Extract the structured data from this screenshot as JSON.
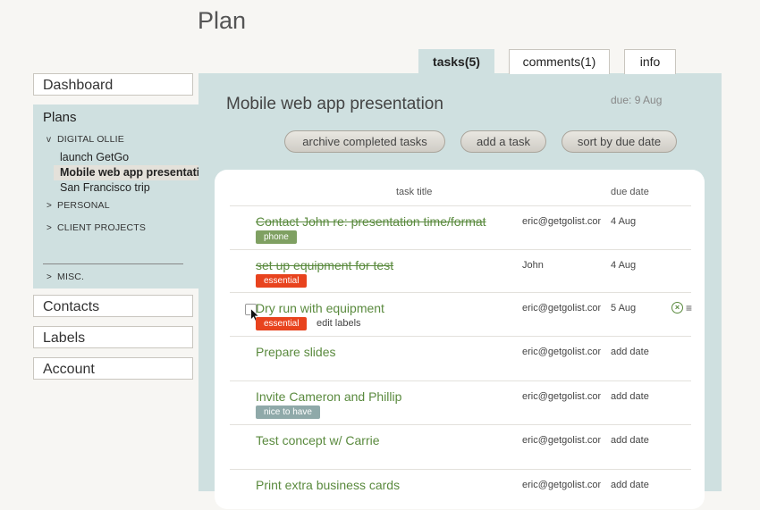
{
  "page": {
    "title": "Plan"
  },
  "sidebar": {
    "dashboard": "Dashboard",
    "plans_label": "Plans",
    "groups": [
      {
        "label": "DIGITAL OLLIE",
        "arrow": "v"
      },
      {
        "label": "PERSONAL",
        "arrow": ">"
      },
      {
        "label": "CLIENT PROJECTS",
        "arrow": ">"
      },
      {
        "label": "MISC.",
        "arrow": ">"
      }
    ],
    "plans": [
      "launch GetGo",
      "Mobile web app presentation",
      "San Francisco trip"
    ],
    "contacts": "Contacts",
    "labels": "Labels",
    "account": "Account"
  },
  "tabs": [
    "tasks(5)",
    "comments(1)",
    "info"
  ],
  "plan": {
    "title": "Mobile web app presentation",
    "due": "due: 9 Aug",
    "buttons": [
      "archive completed tasks",
      "add a task",
      "sort by due date"
    ]
  },
  "table": {
    "headers": {
      "title": "task title",
      "due": "due date"
    },
    "rows": [
      {
        "title": "Contact John re: presentation time/format",
        "assignee": "eric@getgolist.com",
        "date": "4 Aug",
        "tag": "phone",
        "done": true
      },
      {
        "title": "set up equipment for test",
        "assignee": "John",
        "date": "4 Aug",
        "tag": "essential",
        "done": true
      },
      {
        "title": "Dry run with equipment",
        "assignee": "eric@getgolist.com",
        "date": "5 Aug",
        "tag": "essential",
        "edit": "edit labels",
        "done": false
      },
      {
        "title": "Prepare slides",
        "assignee": "eric@getgolist.com",
        "date": "add date",
        "done": false
      },
      {
        "title": "Invite Cameron and Phillip",
        "assignee": "eric@getgolist.com",
        "date": "add date",
        "tag": "nice to have",
        "done": false
      },
      {
        "title": "Test concept w/ Carrie",
        "assignee": "eric@getgolist.com",
        "date": "add date",
        "done": false
      },
      {
        "title": "Print extra business cards",
        "assignee": "eric@getgolist.com",
        "date": "add date",
        "done": false
      }
    ]
  },
  "colors": {
    "panel": "#cfe0e0",
    "task_green": "#5a8a3e",
    "tag_phone": "#7fa062",
    "tag_essential": "#e8431e",
    "tag_nice": "#8fa9a9"
  },
  "icons": [
    "checkbox",
    "cursor-arrow-icon",
    "remove-circle-icon",
    "drag-handle-icon"
  ]
}
